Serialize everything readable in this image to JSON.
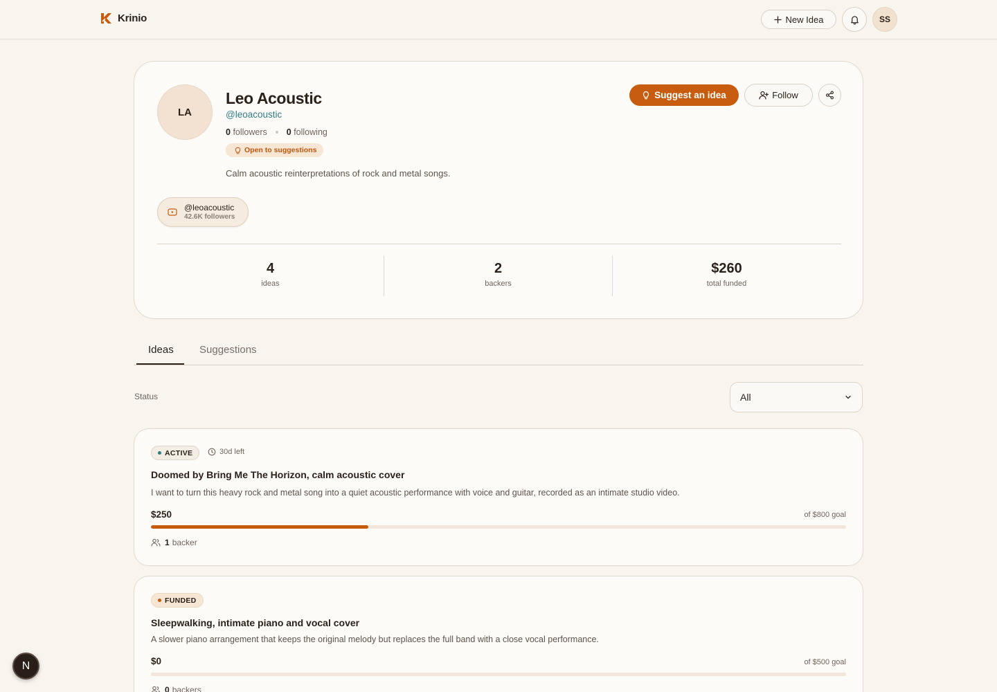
{
  "brand": {
    "name": "Krinio",
    "accent": "#c75b0e"
  },
  "header": {
    "new_idea_label": "New Idea",
    "user_initials": "SS"
  },
  "profile": {
    "initials": "LA",
    "name": "Leo Acoustic",
    "handle": "@leoacoustic",
    "followers_count": "0",
    "followers_label": "followers",
    "following_count": "0",
    "following_label": "following",
    "open_badge": "Open to suggestions",
    "bio": "Calm acoustic reinterpretations of rock and metal songs.",
    "social": {
      "icon": "youtube-icon",
      "handle": "@leoacoustic",
      "followers": "42.6K followers"
    },
    "actions": {
      "suggest_label": "Suggest an idea",
      "follow_label": "Follow"
    },
    "stats": [
      {
        "value": "4",
        "label": "ideas"
      },
      {
        "value": "2",
        "label": "backers"
      },
      {
        "value": "$260",
        "label": "total funded"
      }
    ]
  },
  "tabs": [
    {
      "label": "Ideas",
      "active": true
    },
    {
      "label": "Suggestions",
      "active": false
    }
  ],
  "filter": {
    "label": "Status",
    "value": "All"
  },
  "ideas": [
    {
      "status": "ACTIVE",
      "status_color": "#2f7d86",
      "time_left": "30d left",
      "title": "Doomed by Bring Me The Horizon, calm acoustic cover",
      "description": "I want to turn this heavy rock and metal song into a quiet acoustic performance with voice and guitar, recorded as an intimate studio video.",
      "raised": "$250",
      "goal": "of $800 goal",
      "progress": 0.3125,
      "backers_count": "1",
      "backers_label": "backer"
    },
    {
      "status": "FUNDED",
      "status_color": "#c75b0e",
      "title": "Sleepwalking, intimate piano and vocal cover",
      "description": "A slower piano arrangement that keeps the original melody but replaces the full band with a close vocal performance.",
      "raised": "$0",
      "goal": "of $500 goal",
      "progress": 0,
      "backers_count": "0",
      "backers_label": "backers"
    }
  ],
  "dev_badge": "N"
}
